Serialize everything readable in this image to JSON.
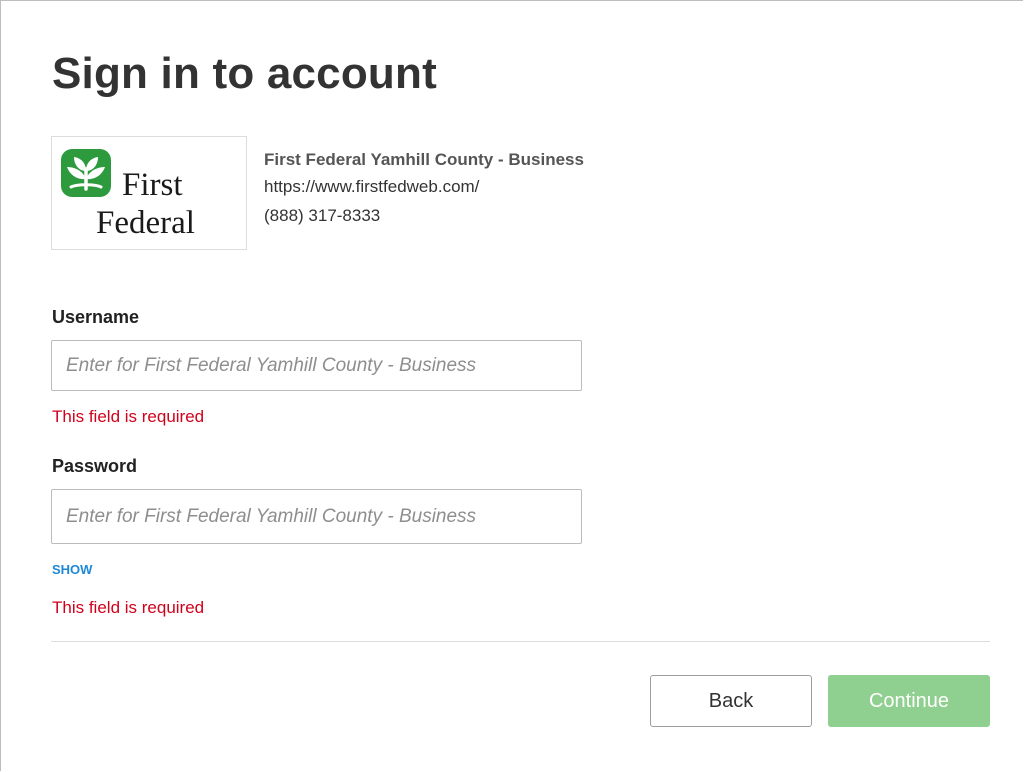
{
  "page": {
    "title": "Sign in to account"
  },
  "institution": {
    "logo_line1": "First",
    "logo_line2": "Federal",
    "name": "First Federal Yamhill County - Business",
    "url": "https://www.firstfedweb.com/",
    "phone": "(888) 317-8333",
    "logo_icon": "leaf-emblem-icon",
    "brand_color": "#2e9a3e"
  },
  "form": {
    "username": {
      "label": "Username",
      "value": "",
      "placeholder": "Enter for First Federal Yamhill County - Business",
      "error": "This field is required"
    },
    "password": {
      "label": "Password",
      "value": "",
      "placeholder": "Enter for First Federal Yamhill County - Business",
      "toggle_label": "SHOW",
      "error": "This field is required"
    }
  },
  "actions": {
    "back_label": "Back",
    "continue_label": "Continue",
    "continue_color": "#8fcf8f",
    "error_color": "#d0021b",
    "link_color": "#1e88d6"
  }
}
